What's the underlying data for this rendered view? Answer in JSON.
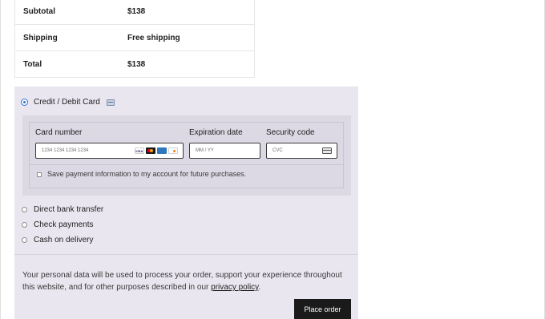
{
  "totals": {
    "rows": [
      {
        "label": "Subtotal",
        "value": "$138"
      },
      {
        "label": "Shipping",
        "value": "Free shipping"
      },
      {
        "label": "Total",
        "value": "$138"
      }
    ]
  },
  "payment": {
    "card_method_label": "Credit / Debit Card",
    "card_number_label": "Card number",
    "card_number_placeholder": "1234 1234 1234 1234",
    "expiration_label": "Expiration date",
    "expiration_placeholder": "MM / YY",
    "security_label": "Security code",
    "security_placeholder": "CVC",
    "save_payment_label": "Save payment information to my account for future purchases.",
    "other_methods": [
      {
        "label": "Direct bank transfer"
      },
      {
        "label": "Check payments"
      },
      {
        "label": "Cash on delivery"
      }
    ],
    "selected_method": "Credit / Debit Card"
  },
  "privacy": {
    "text_before": "Your personal data will be used to process your order, support your experience throughout this website, and for other purposes described in our ",
    "link_text": "privacy policy",
    "text_after": "."
  },
  "actions": {
    "place_order_label": "Place order"
  },
  "colors": {
    "accent": "#2b6fd6",
    "payment_bg": "#e9e6ef",
    "button_bg": "#1a1a1a"
  },
  "icons": [
    "card-icon",
    "visa-icon",
    "mastercard-icon",
    "amex-icon",
    "discover-icon",
    "cvc-card-icon"
  ]
}
